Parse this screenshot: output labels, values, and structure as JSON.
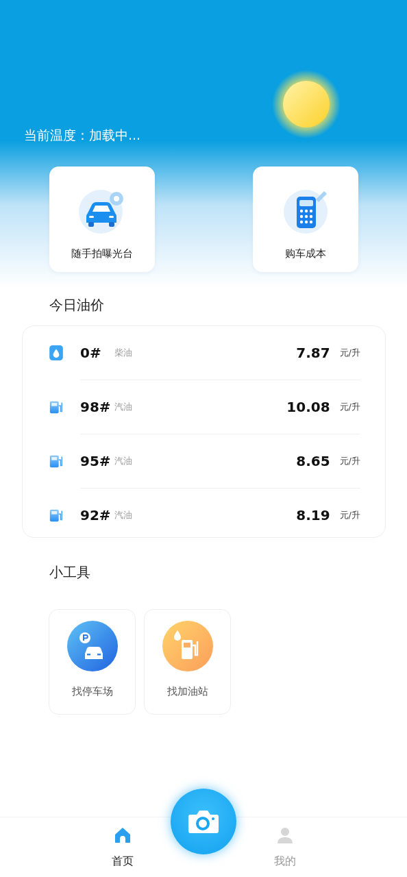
{
  "header": {
    "temperature": "当前温度：加载中..."
  },
  "quick_tools": [
    {
      "kind": "car",
      "label": "随手拍曝光台"
    },
    {
      "kind": "calculator",
      "label": "购车成本"
    }
  ],
  "oil_prices": {
    "title": "今日油价",
    "rows": [
      {
        "kind": "diesel",
        "grade": "0#",
        "type": "柴油",
        "price": "7.87",
        "unit": "元/升"
      },
      {
        "kind": "gasoline",
        "grade": "98#",
        "type": "汽油",
        "price": "10.08",
        "unit": "元/升"
      },
      {
        "kind": "gasoline",
        "grade": "95#",
        "type": "汽油",
        "price": "8.65",
        "unit": "元/升"
      },
      {
        "kind": "gasoline",
        "grade": "92#",
        "type": "汽油",
        "price": "8.19",
        "unit": "元/升"
      }
    ]
  },
  "tools": {
    "title": "小工具",
    "items": [
      {
        "kind": "parking",
        "label": "找停车场"
      },
      {
        "kind": "gas",
        "label": "找加油站"
      }
    ]
  },
  "nav": [
    {
      "kind": "home",
      "label": "首页",
      "selected": true
    },
    {
      "kind": "me",
      "label": "我的",
      "selected": false
    }
  ]
}
